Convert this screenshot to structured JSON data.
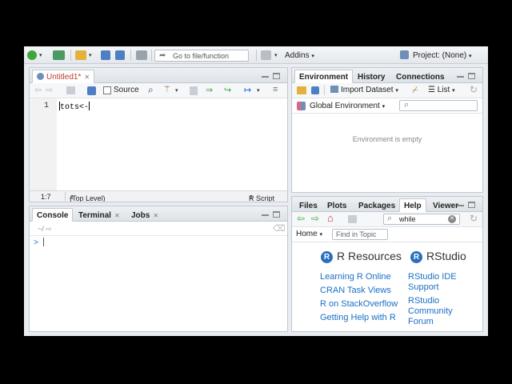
{
  "toolbar": {
    "goto_placeholder": "Go to file/function",
    "addins_label": "Addins",
    "project_label": "Project: (None)"
  },
  "source": {
    "tab_label": "Untitled1*",
    "source_checkbox_label": "Source",
    "line_number": "1",
    "code_text": "tots<-",
    "status_position": "1:7",
    "status_scope": "(Top Level)",
    "status_filetype": "R Script"
  },
  "console": {
    "tabs": [
      "Console",
      "Terminal",
      "Jobs"
    ],
    "path": "~/",
    "prompt": ">"
  },
  "env": {
    "tabs": [
      "Environment",
      "History",
      "Connections"
    ],
    "import_label": "Import Dataset",
    "list_label": "List",
    "global_env_label": "Global Environment",
    "empty_message": "Environment is empty"
  },
  "help": {
    "tabs": [
      "Files",
      "Plots",
      "Packages",
      "Help",
      "Viewer"
    ],
    "search_value": "while",
    "home_label": "Home",
    "find_placeholder": "Find in Topic",
    "r_resources_heading": "R Resources",
    "rstudio_heading": "RStudio",
    "r_logo_letter": "R",
    "left_links": [
      "Learning R Online",
      "CRAN Task Views",
      "R on StackOverflow",
      "Getting Help with R"
    ],
    "right_links": [
      "RStudio IDE Support",
      "RStudio Community Forum"
    ]
  },
  "colors": {
    "accent_blue": "#1a6fc4",
    "new_file_green": "#3fa63f",
    "toolbar_bg": "#e9edf1"
  },
  "icons": [
    "new-file-icon",
    "open-project-icon",
    "open-folder-icon",
    "save-icon",
    "save-all-icon",
    "print-icon",
    "grid-icon",
    "r-project-icon",
    "search-icon",
    "magic-wand-icon",
    "broom-icon",
    "refresh-icon",
    "home-icon",
    "back-arrow-icon",
    "forward-arrow-icon"
  ]
}
